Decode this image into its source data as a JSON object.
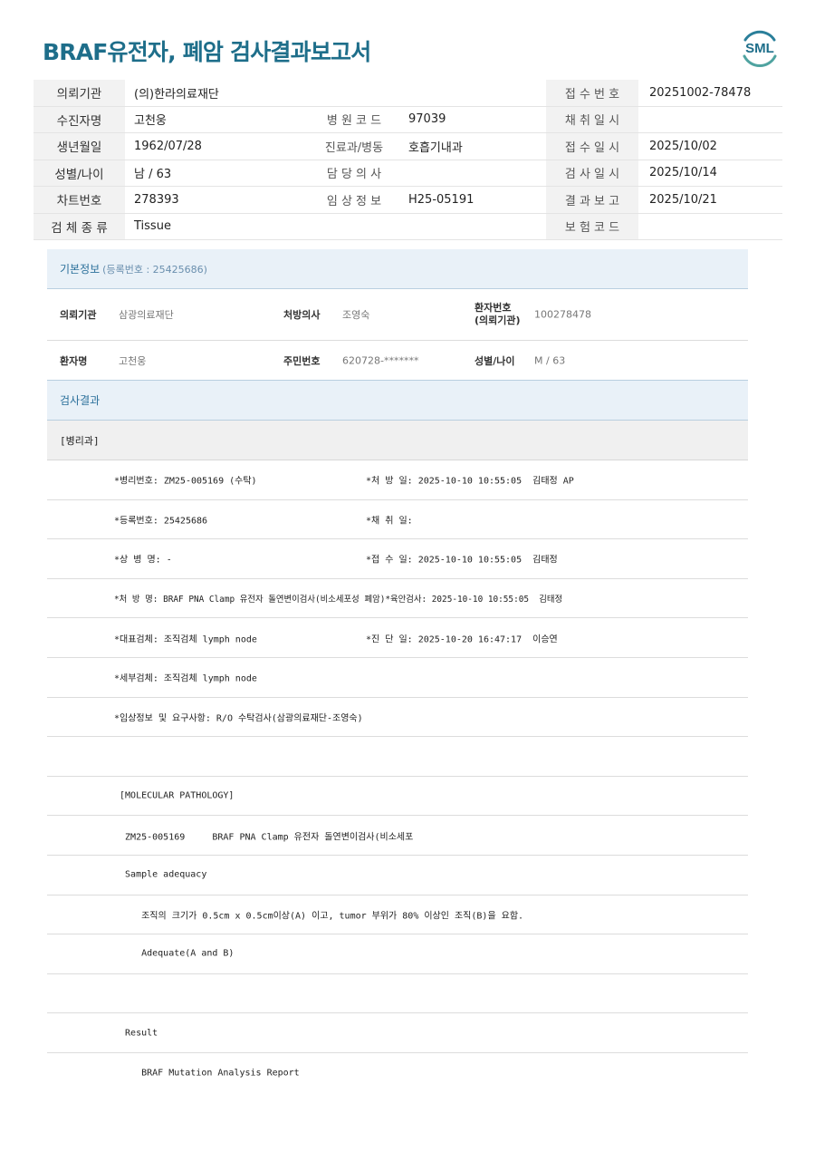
{
  "report": {
    "title": "BRAF유전자, 폐암 검사결과보고서",
    "logo_text": "SML"
  },
  "header_rows": [
    {
      "l1": "의뢰기관",
      "v1": "(의)한라의료재단",
      "l2": "",
      "v2": "",
      "l3": "접 수 번 호",
      "v3": "20251002-78478"
    },
    {
      "l1": "수진자명",
      "v1": "고천웅",
      "l2": "병 원 코 드",
      "v2": "97039",
      "l3": "채 취 일 시",
      "v3": ""
    },
    {
      "l1": "생년월일",
      "v1": "1962/07/28",
      "l2": "진료과/병동",
      "v2": "호흡기내과",
      "l3": "접 수 일 시",
      "v3": "2025/10/02"
    },
    {
      "l1": "성별/나이",
      "v1": "남 / 63",
      "l2": "담 당 의 사",
      "v2": "",
      "l3": "검 사 일 시",
      "v3": "2025/10/14"
    },
    {
      "l1": "차트번호",
      "v1": "278393",
      "l2": "임 상 정 보",
      "v2": "H25-05191",
      "l3": "결 과 보 고",
      "v3": "2025/10/21"
    },
    {
      "l1": "검 체 종 류",
      "v1": "Tissue",
      "l2": "",
      "v2": "",
      "l3": "보 험 코 드",
      "v3": ""
    }
  ],
  "basic_info": {
    "heading": "기본정보",
    "reg_label": "(등록번호 : 25425686)",
    "row1": {
      "inst_label": "의뢰기관",
      "inst_value": "삼광의료재단",
      "doctor_label": "처방의사",
      "doctor_value": "조영숙",
      "patient_no_label_1": "환자번호",
      "patient_no_label_2": "(의뢰기관)",
      "patient_no_value": "100278478"
    },
    "row2": {
      "name_label": "환자명",
      "name_value": "고천웅",
      "rrn_label": "주민번호",
      "rrn_value": "620728-*******",
      "sex_label": "성별/나이",
      "sex_value": "M / 63"
    }
  },
  "results": {
    "heading": "검사결과",
    "dept": "[병리과]",
    "lines": [
      {
        "a": "*병리번호: ZM25-005169 (수탁)",
        "b": "*처 방 일: 2025-10-10 10:55:05  김태정 AP"
      },
      {
        "a": "*등록번호: 25425686",
        "b": "*채 취 일:"
      },
      {
        "a": "*상 병 명: -",
        "b": "*접 수 일: 2025-10-10 10:55:05  김태정"
      },
      {
        "a": "*처 방 명: BRAF PNA Clamp 유전자 돌연변이검사(비소세포성 폐암)*육안검사: 2025-10-10 10:55:05  김태정",
        "b": ""
      },
      {
        "a": "*대표검체: 조직검체 lymph node",
        "b": "*진 단 일: 2025-10-20 16:47:17  이승연"
      },
      {
        "a": "*세부검체: 조직검체 lymph node",
        "b": ""
      },
      {
        "a": "*임상정보 및 요구사항: R/O 수탁검사(삼광의료재단-조영숙)",
        "b": ""
      },
      {
        "a": "",
        "b": ""
      },
      {
        "a": " [MOLECULAR PATHOLOGY]",
        "b": ""
      },
      {
        "a": "  ZM25-005169     BRAF PNA Clamp 유전자 돌연변이검사(비소세포",
        "b": ""
      },
      {
        "a": "  Sample adequacy",
        "b": ""
      },
      {
        "a": "     조직의 크기가 0.5cm x 0.5cm이상(A) 이고, tumor 부위가 80% 이상인 조직(B)을 요함.",
        "b": ""
      },
      {
        "a": "     Adequate(A and B)",
        "b": ""
      },
      {
        "a": "",
        "b": ""
      },
      {
        "a": "  Result",
        "b": ""
      },
      {
        "a": "     BRAF Mutation Analysis Report",
        "b": ""
      }
    ]
  }
}
